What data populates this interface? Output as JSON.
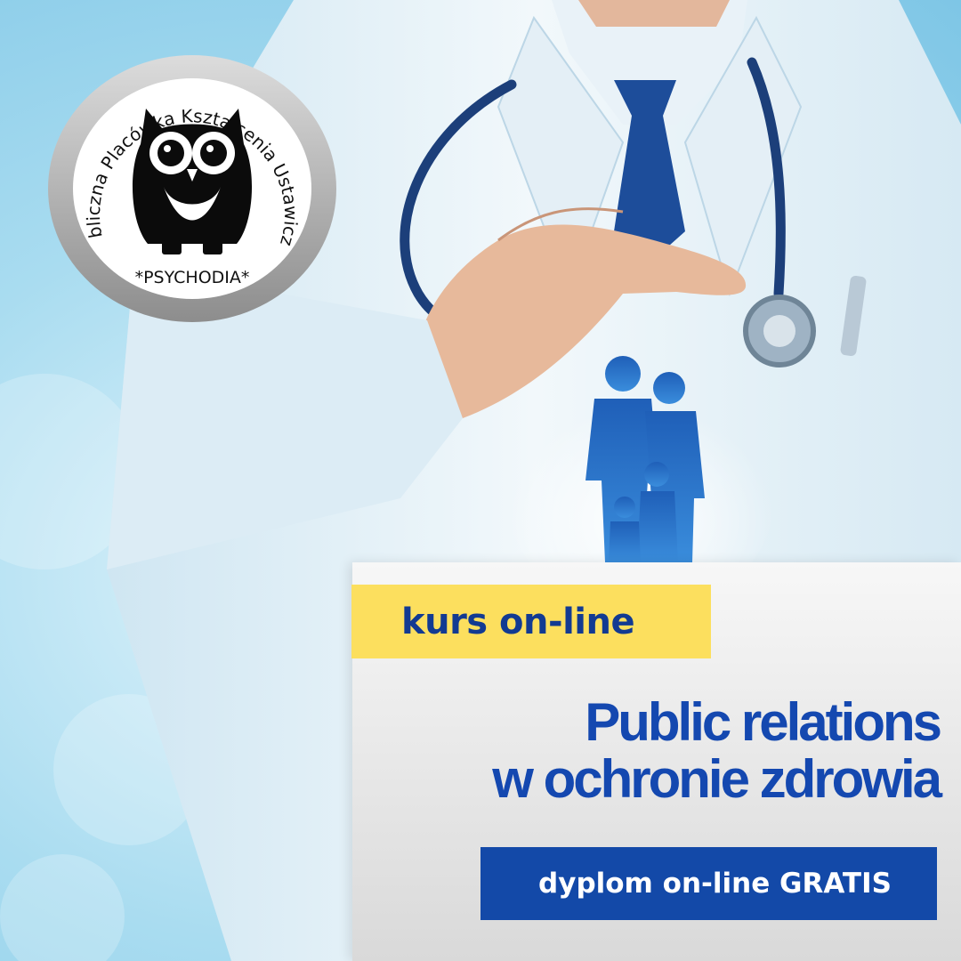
{
  "logo": {
    "arc_text": "Niepubliczna Placówka Kształcenia Ustawicznego",
    "name": "*PSYCHODIA*",
    "icon": "owl-icon"
  },
  "course_tag": "kurs on-line",
  "title": {
    "line1": "Public relations",
    "line2": "w ochronie zdrowia"
  },
  "cta": {
    "label": "dyplom on-line GRATIS"
  },
  "colors": {
    "brand_blue": "#1448b0",
    "tag_yellow": "#fcdf5e",
    "button_blue": "#1349a8",
    "background_blue": "#a9dcf0"
  }
}
